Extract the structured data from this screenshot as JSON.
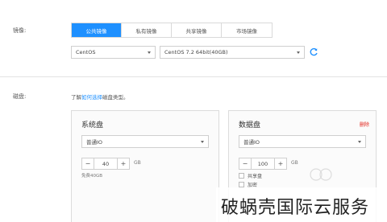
{
  "image_section": {
    "label": "镜像:",
    "tabs": [
      {
        "label": "公共镜像",
        "active": true
      },
      {
        "label": "私有镜像",
        "active": false
      },
      {
        "label": "共享镜像",
        "active": false
      },
      {
        "label": "市场镜像",
        "active": false
      }
    ],
    "os_select": {
      "value": "CentOS"
    },
    "version_select": {
      "value": "CentOS 7.2 64bit(40GB)"
    },
    "refresh_icon": "refresh-icon"
  },
  "disk_section": {
    "label": "磁盘:",
    "hint_prefix": "了解",
    "hint_link": "如何选择",
    "hint_suffix": "磁盘类型。",
    "system_disk": {
      "title": "系统盘",
      "type_select": "普通IO",
      "size": "40",
      "unit": "GB",
      "note": "免费40GB"
    },
    "data_disk": {
      "title": "数据盘",
      "delete_label": "删除",
      "type_select": "普通IO",
      "size": "100",
      "unit": "GB",
      "options": [
        "共享盘",
        "加密"
      ]
    }
  },
  "watermark": {
    "text": "破蜗壳国际云服务"
  },
  "colors": {
    "accent": "#1e90ff",
    "danger": "#e2231a"
  }
}
